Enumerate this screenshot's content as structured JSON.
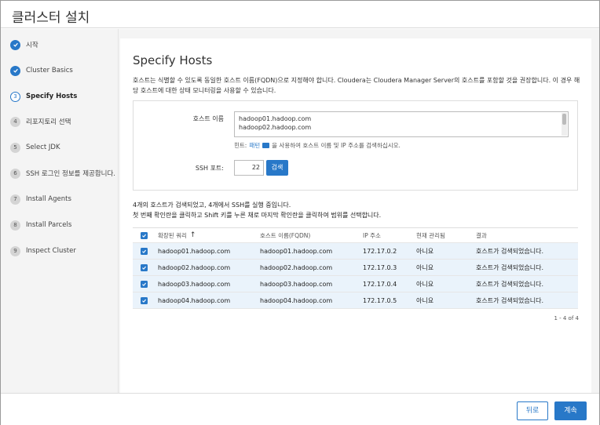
{
  "window": {
    "title": "클러스터 설치"
  },
  "colors": {
    "accent": "#2878c8",
    "selected_row": "#eaf3fb",
    "sidebar_bg": "#f4f4f4"
  },
  "sidebar": {
    "steps": [
      {
        "num": "1",
        "label": "시작",
        "state": "done"
      },
      {
        "num": "2",
        "label": "Cluster Basics",
        "state": "done"
      },
      {
        "num": "3",
        "label": "Specify Hosts",
        "state": "current"
      },
      {
        "num": "4",
        "label": "리포지토리 선택",
        "state": "todo"
      },
      {
        "num": "5",
        "label": "Select JDK",
        "state": "todo"
      },
      {
        "num": "6",
        "label": "SSH 로그인 정보를 제공합니다.",
        "state": "todo"
      },
      {
        "num": "7",
        "label": "Install Agents",
        "state": "todo"
      },
      {
        "num": "8",
        "label": "Install Parcels",
        "state": "todo"
      },
      {
        "num": "9",
        "label": "Inspect Cluster",
        "state": "todo"
      }
    ]
  },
  "main": {
    "title": "Specify Hosts",
    "description": "호스트는 식별할 수 있도록 동일한 호스트 이름(FQDN)으로 지정해야 합니다. Cloudera는 Cloudera Manager Server의 호스트를 포함할 것을 권장합니다. 이 경우 해당 호스트에 대한 상태 모니터링을 사용할 수 있습니다.",
    "form": {
      "hostname_label": "호스트 이름",
      "hostname_lines": [
        "hadoop01.hadoop.com",
        "hadoop02.hadoop.com"
      ],
      "hint_prefix": "힌트: ",
      "hint_link": "패턴",
      "hint_suffix": "을 사용하여 호스트 이름 및 IP 주소를 검색하십시오.",
      "ssh_port_label": "SSH 포트:",
      "ssh_port_value": "22",
      "search_button": "검색"
    },
    "status_line1": "4개의 호스트가 검색되었고, 4개에서 SSH를 실행 중입니다.",
    "status_line2": "첫 번째 확인란을 클릭하고 Shift 키를 누른 채로 마지막 확인란을 클릭하여 범위를 선택합니다.",
    "table": {
      "headers": {
        "expanded_query": "확장된 쿼리",
        "sort_icon": "↑",
        "hostname": "호스트 이름(FQDN)",
        "ip": "IP 주소",
        "managed": "현재 관리됨",
        "result": "결과"
      },
      "rows": [
        {
          "query": "hadoop01.hadoop.com",
          "fqdn": "hadoop01.hadoop.com",
          "ip": "172.17.0.2",
          "managed": "아니요",
          "result": "호스트가 검색되었습니다."
        },
        {
          "query": "hadoop02.hadoop.com",
          "fqdn": "hadoop02.hadoop.com",
          "ip": "172.17.0.3",
          "managed": "아니요",
          "result": "호스트가 검색되었습니다."
        },
        {
          "query": "hadoop03.hadoop.com",
          "fqdn": "hadoop03.hadoop.com",
          "ip": "172.17.0.4",
          "managed": "아니요",
          "result": "호스트가 검색되었습니다."
        },
        {
          "query": "hadoop04.hadoop.com",
          "fqdn": "hadoop04.hadoop.com",
          "ip": "172.17.0.5",
          "managed": "아니요",
          "result": "호스트가 검색되었습니다."
        }
      ],
      "pager": "1 - 4 of 4"
    }
  },
  "footer": {
    "back_label": "뒤로",
    "next_label": "계속"
  }
}
